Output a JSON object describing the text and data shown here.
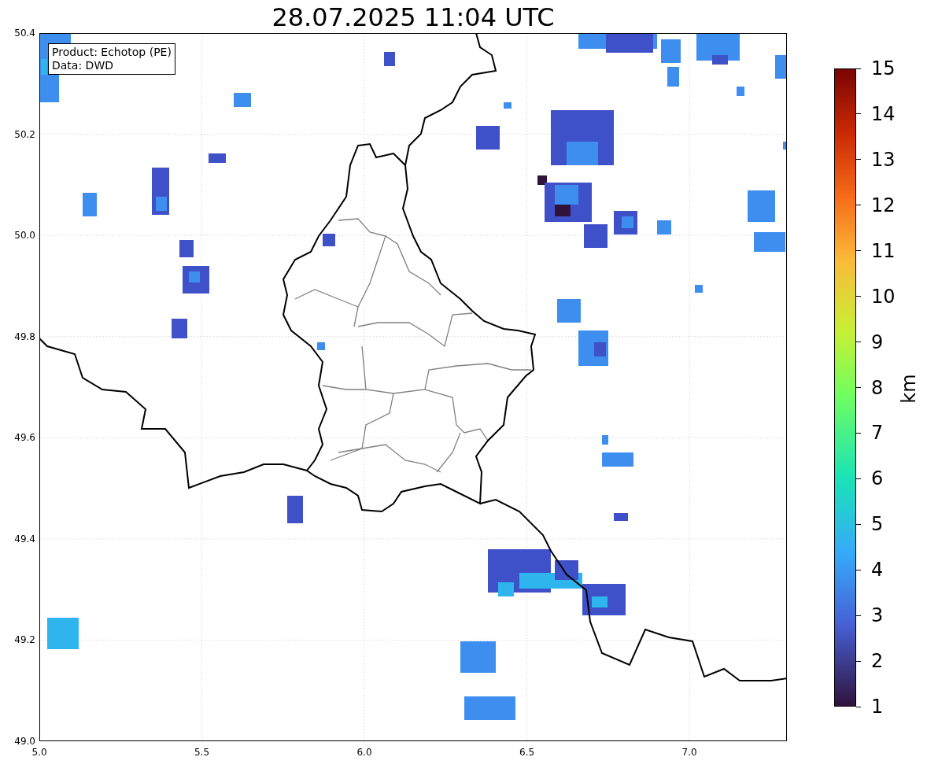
{
  "title": "28.07.2025 11:04 UTC",
  "legend": [
    "Product: Echotop (PE)",
    "Data: DWD"
  ],
  "axes": {
    "x_ticks": [
      "5.0",
      "5.5",
      "6.0",
      "6.5",
      "7.0"
    ],
    "y_ticks": [
      "50.4",
      "50.2",
      "50.0",
      "49.8",
      "49.6",
      "49.4",
      "49.2",
      "49.0"
    ]
  },
  "colorbar": {
    "label": "km",
    "ticks": [
      "15",
      "14",
      "13",
      "12",
      "11",
      "10",
      "9",
      "8",
      "7",
      "6",
      "5",
      "4",
      "3",
      "2",
      "1"
    ]
  }
}
